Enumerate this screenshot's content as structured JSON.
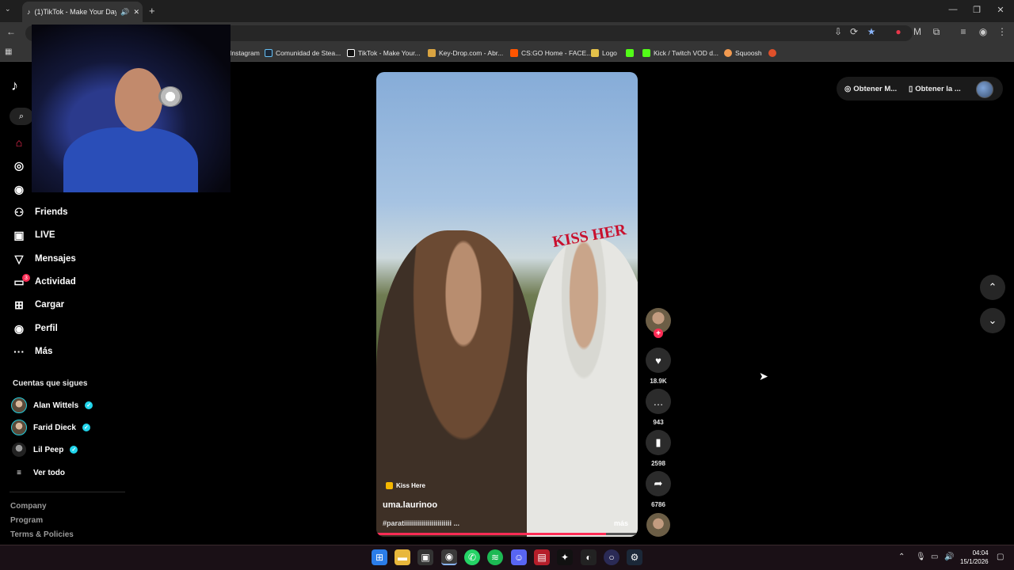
{
  "browser": {
    "tab_title": "(1)TikTok - Make Your Day",
    "bookmarks": [
      "Instagram",
      "Comunidad de Stea...",
      "TikTok - Make Your...",
      "Key-Drop.com - Abr...",
      "CS:GO Home - FACE...",
      "Logo",
      "",
      "Kick / Twitch VOD d...",
      "Squoosh",
      ""
    ]
  },
  "sidebar": {
    "items": [
      {
        "label": "Friends",
        "icon": "friends-icon"
      },
      {
        "label": "LIVE",
        "icon": "live-icon"
      },
      {
        "label": "Mensajes",
        "icon": "messages-icon"
      },
      {
        "label": "Actividad",
        "icon": "activity-icon",
        "badge": "3"
      },
      {
        "label": "Cargar",
        "icon": "upload-icon"
      },
      {
        "label": "Perfil",
        "icon": "profile-icon"
      },
      {
        "label": "Más",
        "icon": "more-icon"
      }
    ],
    "following_title": "Cuentas que sigues",
    "following": [
      "Alan Wittels",
      "Farid Dieck",
      "Lil Peep"
    ],
    "see_all": "Ver todo",
    "footer": [
      "Company",
      "Program",
      "Terms & Policies"
    ]
  },
  "video": {
    "sound": "Kiss Here",
    "author": "uma.laurinoo",
    "caption": "#paratiiiiiiiiiiiiiiiiiiiiiiii ...",
    "more": "más",
    "overlay_text": "KISS HER",
    "progress": 0.88
  },
  "actions": {
    "likes": "18.9K",
    "comments": "943",
    "saves": "2598",
    "shares": "6786"
  },
  "topbar": {
    "get_coins": "Obtener M...",
    "get_app": "Obtener la ..."
  },
  "taskbar": {
    "time": "04:04",
    "date": "15/1/2026"
  },
  "colors": {
    "accent": "#fe2c55",
    "verified": "#20d5ec"
  }
}
